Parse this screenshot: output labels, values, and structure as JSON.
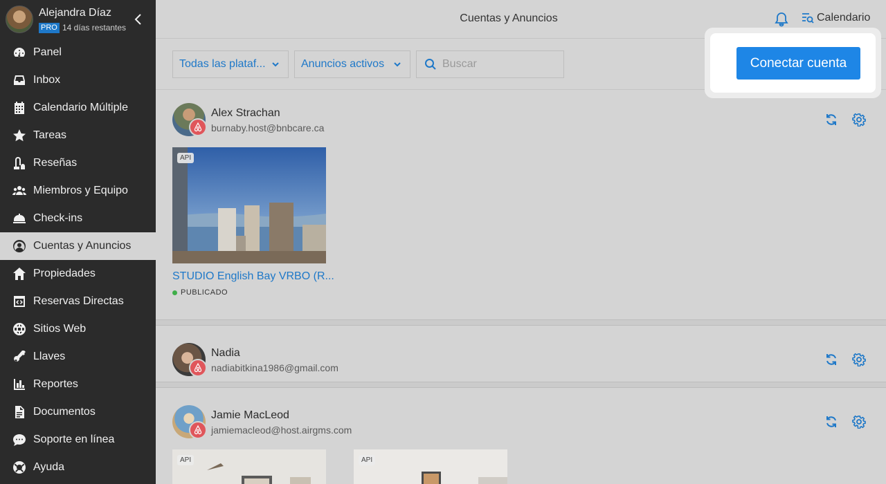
{
  "profile": {
    "name": "Alejandra Díaz",
    "plan_badge": "PRO",
    "days_left": "14 días restantes"
  },
  "sidebar": {
    "items": [
      {
        "label": "Panel",
        "icon": "dashboard-icon"
      },
      {
        "label": "Inbox",
        "icon": "inbox-icon"
      },
      {
        "label": "Calendario Múltiple",
        "icon": "calendar-grid-icon"
      },
      {
        "label": "Tareas",
        "icon": "star-icon"
      },
      {
        "label": "Reseñas",
        "icon": "vacuum-icon"
      },
      {
        "label": "Miembros y Equipo",
        "icon": "team-icon"
      },
      {
        "label": "Check-ins",
        "icon": "service-bell-icon"
      },
      {
        "label": "Cuentas y Anuncios",
        "icon": "user-circle-icon",
        "active": true
      },
      {
        "label": "Propiedades",
        "icon": "home-icon"
      },
      {
        "label": "Reservas Directas",
        "icon": "code-window-icon"
      },
      {
        "label": "Sitios Web",
        "icon": "globe-icon"
      },
      {
        "label": "Llaves",
        "icon": "key-icon"
      },
      {
        "label": "Reportes",
        "icon": "bar-chart-icon"
      },
      {
        "label": "Documentos",
        "icon": "document-icon"
      },
      {
        "label": "Soporte en línea",
        "icon": "chat-icon"
      },
      {
        "label": "Ayuda",
        "icon": "lifebuoy-icon"
      }
    ]
  },
  "header": {
    "title": "Cuentas y Anuncios",
    "calendar_label": "Calendario"
  },
  "filters": {
    "platform": "Todas las plataf...",
    "ads": "Anuncios activos",
    "search_placeholder": "Buscar"
  },
  "connect_button": "Conectar cuenta",
  "accounts": [
    {
      "name": "Alex Strachan",
      "email": "burnaby.host@bnbcare.ca",
      "listings": [
        {
          "api_tag": "API",
          "title": "STUDIO English Bay VRBO (R...",
          "status": "PUBLICADO"
        }
      ]
    },
    {
      "name": "Nadia",
      "email": "nadiabitkina1986@gmail.com",
      "listings": []
    },
    {
      "name": "Jamie MacLeod",
      "email": "jamiemacleod@host.airgms.com",
      "listings": [
        {
          "api_tag": "API"
        },
        {
          "api_tag": "API"
        }
      ]
    }
  ],
  "colors": {
    "sidebar_bg": "#2b2b2b",
    "accent": "#1e78c8",
    "button": "#1e86e6",
    "airbnb": "#e0565b",
    "published": "#3fae49"
  }
}
